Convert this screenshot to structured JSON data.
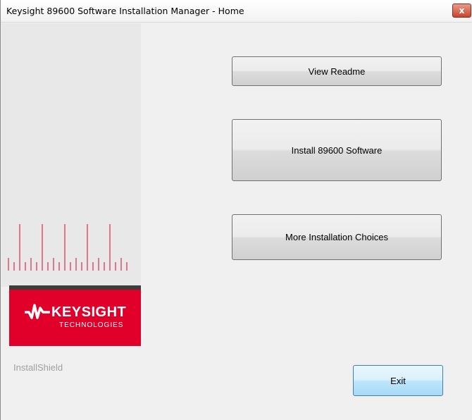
{
  "window": {
    "title": "Keysight 89600 Software Installation Manager - Home",
    "close_glyph": "x"
  },
  "buttons": {
    "view_readme": "View Readme",
    "install": "Install 89600 Software",
    "more_choices": "More Installation Choices",
    "exit": "Exit"
  },
  "brand": {
    "name": "KEYSIGHT",
    "sub": "TECHNOLOGIES",
    "color": "#e1002a"
  },
  "footer": {
    "installshield": "InstallShield"
  },
  "icons": {
    "logo": "keysight-wave-logo",
    "close": "close-icon",
    "decor": "tick-marks-decoration"
  }
}
